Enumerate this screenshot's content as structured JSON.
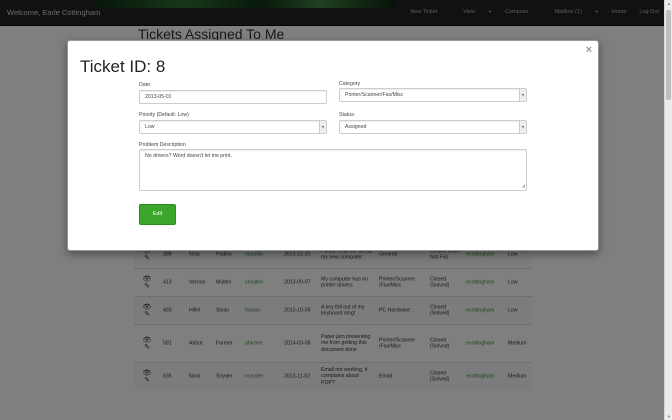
{
  "navbar": {
    "welcome": "Welcome, Earle Cottingham",
    "items": [
      {
        "label": "New Ticket"
      },
      {
        "label": "View",
        "dropdown": true
      },
      {
        "label": "Compose"
      },
      {
        "label": "Mailbox (1)",
        "dropdown": true
      },
      {
        "label": "Home"
      },
      {
        "label": "Log Out"
      }
    ],
    "dropdown_glyph": "▼"
  },
  "page": {
    "title": "Tickets Assigned To Me"
  },
  "tickets": [
    {
      "id": "398",
      "first": "Nola",
      "last": "Padilla",
      "user": "npadilla",
      "date": "2013-12-20",
      "subject": "Please help me set up my new computer",
      "category": "General",
      "status": "Closed (Can Not Fix)",
      "tech": "ecottingham",
      "priority": "Low"
    },
    {
      "id": "413",
      "first": "Vernon",
      "last": "Mullen",
      "user": "vmullen",
      "date": "2013-09-07",
      "subject": "My computer has no printer drivers",
      "category": "Printer/Scanner /Fax/Misc",
      "status": "Closed (Solved)",
      "tech": "ecottingham",
      "priority": "Low"
    },
    {
      "id": "493",
      "first": "Hillel",
      "last": "Sloan",
      "user": "hsloan",
      "date": "2013-10-05",
      "subject": "A key fell out of my keyboard omg!",
      "category": "PC Hardware",
      "status": "Closed (Solved)",
      "tech": "ecottingham",
      "priority": "Low"
    },
    {
      "id": "581",
      "first": "Abbot",
      "last": "Farmer",
      "user": "afarmer",
      "date": "2014-03-08",
      "subject": "Paper jam preventing me from getting this document done",
      "category": "Printer/Scanner /Fax/Misc",
      "status": "Closed (Solved)",
      "tech": "ecottingham",
      "priority": "Medium"
    },
    {
      "id": "635",
      "first": "Nora",
      "last": "Snyder",
      "user": "nsnyder",
      "date": "2013-11-02",
      "subject": "Email not working, it complains about POP?",
      "category": "Email",
      "status": "Closed (Solved)",
      "tech": "ecottingham",
      "priority": "Medium"
    }
  ],
  "row_icons": {
    "view": "👁",
    "edit": "✎"
  },
  "modal": {
    "title": "Ticket ID: 8",
    "close_glyph": "×",
    "date_label": "Date:",
    "date_value": "2013-05-01",
    "category_label": "Category",
    "category_value": "Printer/Scanner/Fax/Misc",
    "priority_label": "Priority (Default: Low)",
    "priority_value": "Low",
    "status_label": "Status:",
    "status_value": "Assigned",
    "description_label": "Problem Description",
    "description_value": "No drivers? Word doesn't let me print.",
    "edit_label": "Edit",
    "select_glyph": "▼",
    "grip_glyph": "◢"
  },
  "colors": {
    "navbar": "#222222",
    "accent_green": "#3aa52a",
    "link_green": "#3c8b3c",
    "overlay": "rgba(0,0,0,0.5)"
  }
}
